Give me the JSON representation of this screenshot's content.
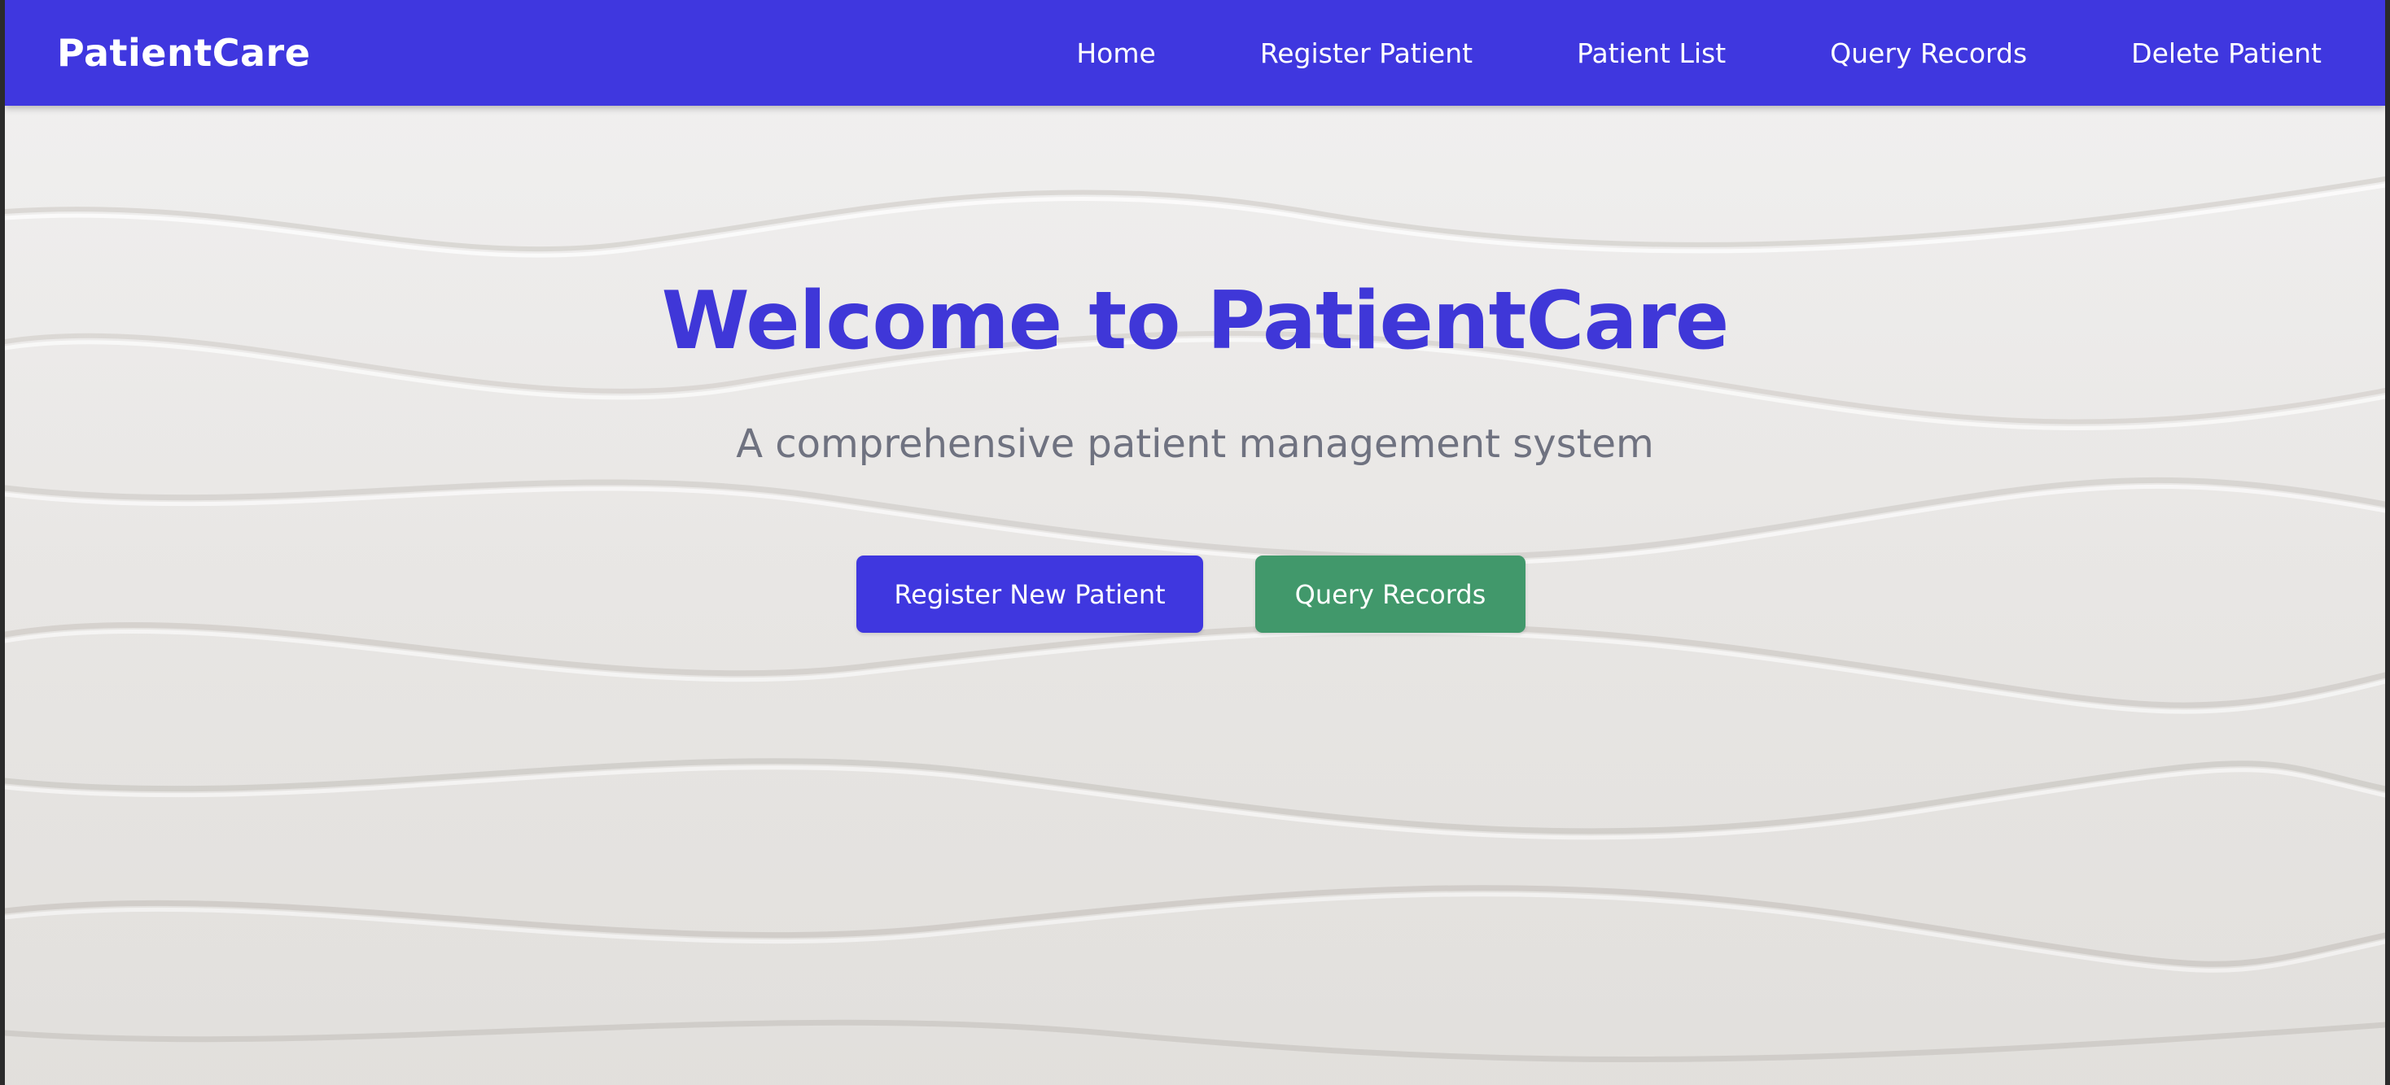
{
  "nav": {
    "brand": "PatientCare",
    "links": [
      {
        "label": "Home"
      },
      {
        "label": "Register Patient"
      },
      {
        "label": "Patient List"
      },
      {
        "label": "Query Records"
      },
      {
        "label": "Delete Patient"
      }
    ]
  },
  "hero": {
    "title": "Welcome to PatientCare",
    "subtitle": "A comprehensive patient management system",
    "buttons": {
      "register_label": "Register New Patient",
      "query_label": "Query Records"
    }
  },
  "colors": {
    "nav_background": "#3f37df",
    "title_color": "#3f37d8",
    "subtitle_color": "#6f7280",
    "primary_button": "#3f37df",
    "success_button": "#41986b",
    "page_background": "#e9e7e4"
  }
}
